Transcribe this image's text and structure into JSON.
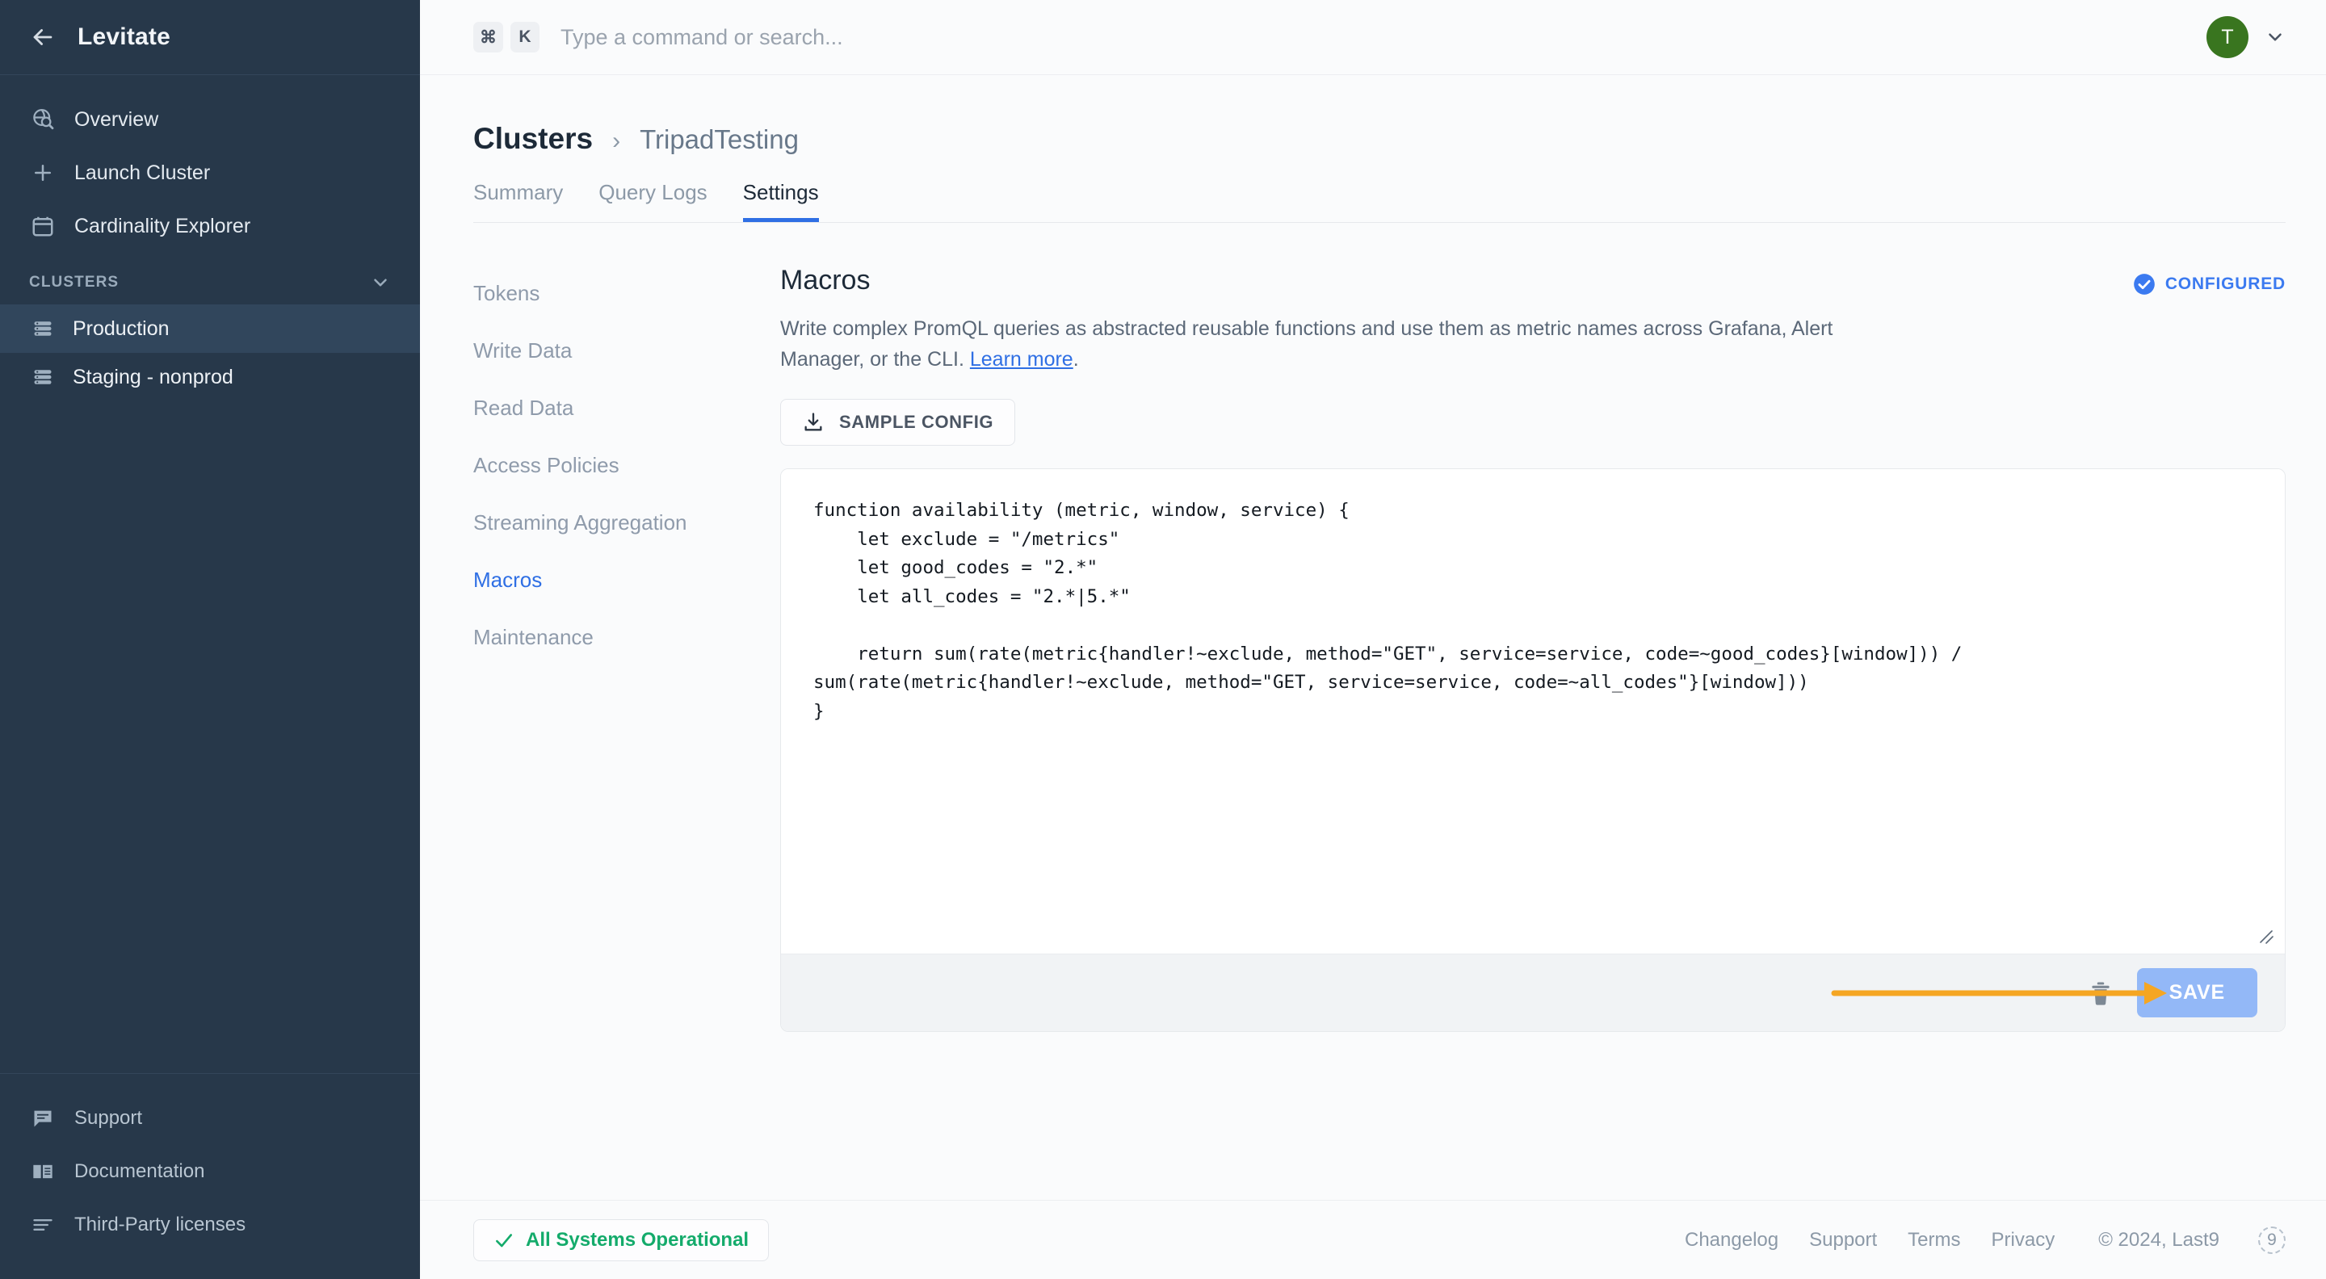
{
  "sidebar": {
    "title": "Levitate",
    "back_icon": "arrow-left-icon",
    "nav": [
      {
        "label": "Overview",
        "icon": "globe-search-icon"
      },
      {
        "label": "Launch Cluster",
        "icon": "plus-icon"
      },
      {
        "label": "Cardinality Explorer",
        "icon": "calendar-icon"
      }
    ],
    "section": {
      "label": "CLUSTERS",
      "icon": "chevron-down-icon"
    },
    "clusters": [
      {
        "label": "Production",
        "icon": "server-icon",
        "active": true
      },
      {
        "label": "Staging - nonprod",
        "icon": "server-icon",
        "active": false
      }
    ],
    "footer": [
      {
        "label": "Support",
        "icon": "chat-icon"
      },
      {
        "label": "Documentation",
        "icon": "book-icon"
      },
      {
        "label": "Third-Party licenses",
        "icon": "list-icon"
      }
    ]
  },
  "topbar": {
    "kbd_cmd": "⌘",
    "kbd_key": "K",
    "search_placeholder": "Type a command or search...",
    "avatar_initial": "T",
    "caret_icon": "chevron-down-icon"
  },
  "breadcrumb": {
    "root": "Clusters",
    "separator": "›",
    "current": "TripadTesting"
  },
  "tabs": [
    {
      "label": "Summary",
      "active": false
    },
    {
      "label": "Query Logs",
      "active": false
    },
    {
      "label": "Settings",
      "active": true
    }
  ],
  "settings_nav": [
    {
      "label": "Tokens",
      "active": false
    },
    {
      "label": "Write Data",
      "active": false
    },
    {
      "label": "Read Data",
      "active": false
    },
    {
      "label": "Access Policies",
      "active": false
    },
    {
      "label": "Streaming Aggregation",
      "active": false
    },
    {
      "label": "Macros",
      "active": true
    },
    {
      "label": "Maintenance",
      "active": false
    }
  ],
  "panel": {
    "title": "Macros",
    "badge": {
      "label": "CONFIGURED",
      "icon": "check-circle-icon",
      "color": "#3b7af0"
    },
    "description_before_link": "Write complex PromQL queries as abstracted reusable functions and use them as metric names across Grafana, Alert Manager, or the CLI. ",
    "link_text": "Learn more",
    "description_after_link": ".",
    "sample_button": {
      "label": "SAMPLE CONFIG",
      "icon": "download-icon"
    },
    "code": "function availability (metric, window, service) {\n    let exclude = \"/metrics\"\n    let good_codes = \"2.*\"\n    let all_codes = \"2.*|5.*\"\n\n    return sum(rate(metric{handler!~exclude, method=\"GET\", service=service, code=~good_codes}[window])) / sum(rate(metric{handler!~exclude, method=\"GET, service=service, code=~all_codes\"}[window]))\n}",
    "resize_icon": "resize-grip-icon",
    "delete_icon": "trash-icon",
    "save_label": "SAVE",
    "annotation": {
      "icon": "arrow-right-annotation",
      "color": "#f5a623"
    }
  },
  "footer": {
    "status": {
      "label": "All Systems Operational",
      "icon": "check-icon",
      "color": "#14ab6b"
    },
    "links": [
      "Changelog",
      "Support",
      "Terms",
      "Privacy"
    ],
    "copyright": "© 2024, Last9",
    "logo": "9"
  }
}
